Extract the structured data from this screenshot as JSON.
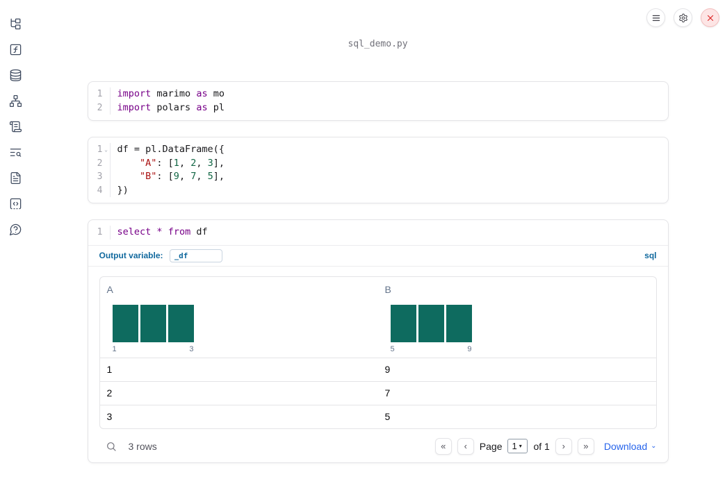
{
  "notebook": {
    "filename": "sql_demo.py",
    "cells": [
      {
        "language": "python",
        "lines": [
          {
            "n": "1",
            "tokens": [
              [
                "kw",
                "import"
              ],
              [
                "pl",
                " marimo "
              ],
              [
                "kw",
                "as"
              ],
              [
                "pl",
                " mo"
              ]
            ]
          },
          {
            "n": "2",
            "tokens": [
              [
                "kw",
                "import"
              ],
              [
                "pl",
                " polars "
              ],
              [
                "kw",
                "as"
              ],
              [
                "pl",
                " pl"
              ]
            ]
          }
        ]
      },
      {
        "language": "python",
        "lines": [
          {
            "n": "1",
            "fold": "⌄",
            "tokens": [
              [
                "pl",
                "df = pl.DataFrame({"
              ]
            ]
          },
          {
            "n": "2",
            "tokens": [
              [
                "pl",
                "    "
              ],
              [
                "str",
                "\"A\""
              ],
              [
                "pl",
                ": ["
              ],
              [
                "num",
                "1"
              ],
              [
                "pl",
                ", "
              ],
              [
                "num",
                "2"
              ],
              [
                "pl",
                ", "
              ],
              [
                "num",
                "3"
              ],
              [
                "pl",
                "],"
              ]
            ]
          },
          {
            "n": "3",
            "tokens": [
              [
                "pl",
                "    "
              ],
              [
                "str",
                "\"B\""
              ],
              [
                "pl",
                ": ["
              ],
              [
                "num",
                "9"
              ],
              [
                "pl",
                ", "
              ],
              [
                "num",
                "7"
              ],
              [
                "pl",
                ", "
              ],
              [
                "num",
                "5"
              ],
              [
                "pl",
                "],"
              ]
            ]
          },
          {
            "n": "4",
            "tokens": [
              [
                "pl",
                "})"
              ]
            ]
          }
        ]
      },
      {
        "language": "sql",
        "lines": [
          {
            "n": "1",
            "tokens": [
              [
                "kw",
                "select"
              ],
              [
                "pl",
                " "
              ],
              [
                "kw",
                "*"
              ],
              [
                "pl",
                " "
              ],
              [
                "kw",
                "from"
              ],
              [
                "pl",
                " df"
              ]
            ]
          }
        ]
      }
    ],
    "sql_cell": {
      "output_variable_label": "Output variable:",
      "output_variable_value": "_df",
      "language_badge": "sql"
    }
  },
  "table": {
    "columns": [
      {
        "name": "A",
        "hist": {
          "type": "bar",
          "values": [
            1,
            1,
            1
          ],
          "min_label": "1",
          "max_label": "3"
        }
      },
      {
        "name": "B",
        "hist": {
          "type": "bar",
          "values": [
            1,
            1,
            1
          ],
          "min_label": "5",
          "max_label": "9"
        }
      }
    ],
    "rows": [
      [
        "1",
        "9"
      ],
      [
        "2",
        "7"
      ],
      [
        "3",
        "5"
      ]
    ],
    "footer": {
      "row_count": "3 rows",
      "page_label": "Page",
      "page_value": "1",
      "page_total": "of 1",
      "download_label": "Download"
    }
  },
  "glyphs": {
    "first_page": "«",
    "prev_page": "‹",
    "next_page": "›",
    "last_page": "»",
    "select_caret": "▾",
    "download_caret": "⌄"
  },
  "sidebar_icons": [
    "file-tree-icon",
    "function-square-icon",
    "database-icon",
    "dependency-graph-icon",
    "scroll-icon",
    "logs-search-icon",
    "document-icon",
    "snippets-icon",
    "help-icon"
  ],
  "colors": {
    "histogram_bar": "#0e6b5f",
    "accent_blue": "#11699e",
    "link_blue": "#2563eb",
    "close_red": "#dc2626"
  }
}
